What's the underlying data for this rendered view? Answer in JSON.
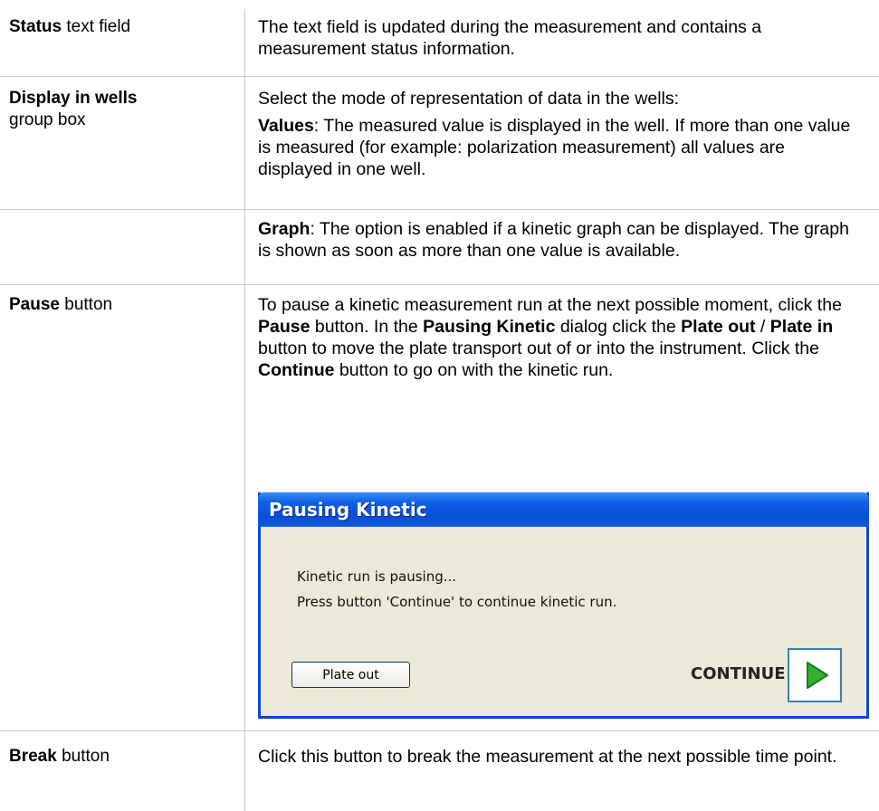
{
  "rows": [
    {
      "term_bold": "Status",
      "term_rest": " text field",
      "desc": "The text field is updated during the measurement and contains a measurement status information."
    },
    {
      "term_bold": "Display in wells",
      "term_rest": "group box",
      "desc_intro": "Select the mode of representation of data in the wells:",
      "values_bold": "Values",
      "values_text": ": The measured value is displayed in the well. If more than one value is measured (for example: polarization measurement) all values are displayed in one well."
    },
    {
      "graph_bold": "Graph",
      "graph_text": ": The option is enabled if a kinetic graph can be displayed. The graph is shown as soon as more than one value is available."
    },
    {
      "term_bold": "Pause",
      "term_rest": " button",
      "p1": "To pause a kinetic measurement run at the next possible moment, click the ",
      "p1_b1": "Pause",
      "p2": " button. In the ",
      "p2_b": "Pausing Kinetic",
      "p3": " dialog click the ",
      "p3_b1": "Plate out",
      "p3_sep": " / ",
      "p3_b2": "Plate in",
      "p4": " button to move the plate transport out of or into the instrument. Click the ",
      "p4_b": "Continue",
      "p5": " button to go on with the kinetic run."
    },
    {
      "term_bold": "Break",
      "term_rest": " button",
      "desc": "Click this button to break the measurement at the next possible time point."
    }
  ],
  "dialog": {
    "title": "Pausing Kinetic",
    "line1": "Kinetic run is pausing...",
    "line2": "Press button 'Continue' to continue kinetic run.",
    "plate_out_label": "Plate out",
    "continue_label": "CONTINUE",
    "colors": {
      "title_bar": "#0a4fd6",
      "body": "#ece9d8",
      "play_icon": "#33b030"
    }
  }
}
